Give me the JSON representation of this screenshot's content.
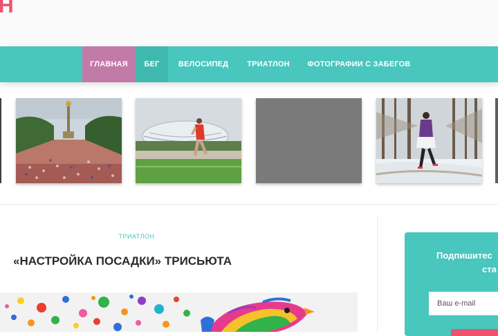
{
  "logo": {
    "visible_fragment": "Н",
    "color": "#f0516c"
  },
  "nav": {
    "background": "#49c6be",
    "active_color": "#c27aa9",
    "items": [
      {
        "label": "ГЛАВНАЯ",
        "active": true
      },
      {
        "label": "БЕГ",
        "active": false
      },
      {
        "label": "ВЕЛОСИПЕД",
        "active": false
      },
      {
        "label": "ТРИАТЛОН",
        "active": false
      },
      {
        "label": "ФОТОГРАФИИ С ЗАБЕГОВ",
        "active": false
      }
    ]
  },
  "carousel": {
    "items": [
      {
        "icon": "marathon-crowd-photo"
      },
      {
        "icon": "runner-stadium-photo"
      },
      {
        "icon": "placeholder-gray-image"
      },
      {
        "icon": "runner-snow-forest-photo"
      }
    ]
  },
  "post": {
    "category": "ТРИАТЛОН",
    "title": "«НАСТРОЙКА ПОСАДКИ» ТРИСЬЮТА",
    "image_icon": "colorful-paint-splash-image"
  },
  "subscribe": {
    "title_line1": "Подпишитес",
    "title_line2": "ста",
    "email_placeholder": "Ваш e-mail",
    "button_color": "#f0516c"
  }
}
